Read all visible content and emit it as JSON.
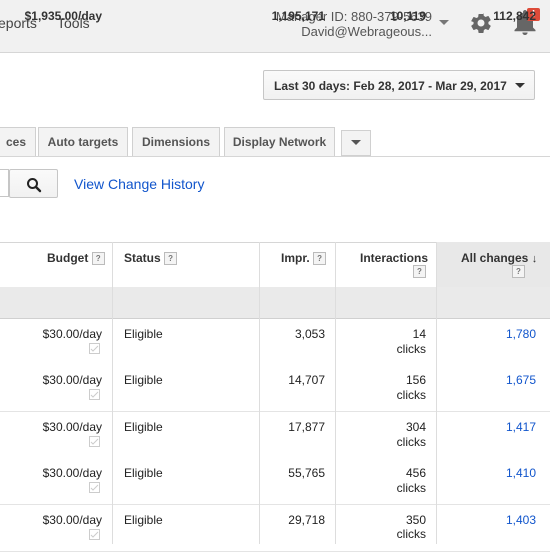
{
  "topnav": {
    "reports_label": "eports",
    "tools_label": "Tools"
  },
  "account": {
    "manager_id": "Manager ID: 880-379-5639",
    "email": "David@Webrageous...",
    "notification_badge": "!"
  },
  "date_range": {
    "label": "Last 30 days: Feb 28, 2017 - Mar 29, 2017"
  },
  "tabs": [
    {
      "label": "ces"
    },
    {
      "label": "Auto targets"
    },
    {
      "label": "Dimensions"
    },
    {
      "label": "Display Network"
    }
  ],
  "toolbar": {
    "change_history_label": "View Change History"
  },
  "table": {
    "headers": {
      "budget": "Budget",
      "status": "Status",
      "impr": "Impr.",
      "interactions": "Interactions",
      "all_changes": "All changes",
      "help_glyph": "?",
      "sort_glyph": "↓"
    },
    "totals": {
      "budget": "$1,935.00/day",
      "impr": "1,195,171",
      "interactions": "10,119",
      "all_changes": "112,842"
    },
    "rows": [
      {
        "budget": "$30.00/day",
        "status": "Eligible",
        "impr": "3,053",
        "interactions": "14",
        "interactions_unit": "clicks",
        "all_changes": "1,780"
      },
      {
        "budget": "$30.00/day",
        "status": "Eligible",
        "impr": "14,707",
        "interactions": "156",
        "interactions_unit": "clicks",
        "all_changes": "1,675"
      },
      {
        "budget": "$30.00/day",
        "status": "Eligible",
        "impr": "17,877",
        "interactions": "304",
        "interactions_unit": "clicks",
        "all_changes": "1,417"
      },
      {
        "budget": "$30.00/day",
        "status": "Eligible",
        "impr": "55,765",
        "interactions": "456",
        "interactions_unit": "clicks",
        "all_changes": "1,410"
      },
      {
        "budget": "$30.00/day",
        "status": "Eligible",
        "impr": "29,718",
        "interactions": "350",
        "interactions_unit": "clicks",
        "all_changes": "1,403"
      }
    ]
  },
  "colors": {
    "link": "#1155cc",
    "badge": "#dd4b39",
    "topbar": "#f1f1f1"
  }
}
